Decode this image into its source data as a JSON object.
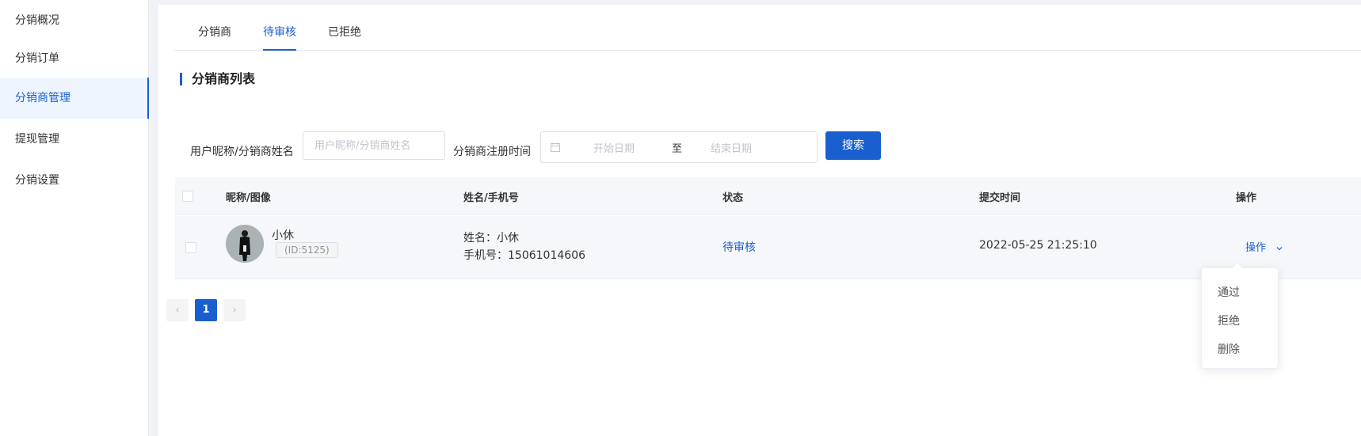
{
  "sidebar": {
    "items": [
      {
        "label": "分销概况"
      },
      {
        "label": "分销订单"
      },
      {
        "label": "分销商管理"
      },
      {
        "label": "提现管理"
      },
      {
        "label": "分销设置"
      }
    ],
    "active_index": 2
  },
  "tabs": [
    {
      "label": "分销商"
    },
    {
      "label": "待审核"
    },
    {
      "label": "已拒绝"
    }
  ],
  "active_tab": 1,
  "section_title": "分销商列表",
  "filters": {
    "name_label": "用户昵称/分销商姓名",
    "name_placeholder": "用户昵称/分销商姓名",
    "date_label": "分销商注册时间",
    "start_placeholder": "开始日期",
    "separator": "至",
    "end_placeholder": "结束日期",
    "search_button": "搜索"
  },
  "table": {
    "columns": [
      "昵称/图像",
      "姓名/手机号",
      "状态",
      "提交时间",
      "操作"
    ],
    "rows": [
      {
        "nickname": "小休",
        "id_badge": "(ID:5125)",
        "name_line": "姓名：小休",
        "phone_line": "手机号：15061014606",
        "status": "待审核",
        "submit_time": "2022-05-25 21:25:10",
        "action": "操作"
      }
    ]
  },
  "pagination": {
    "prev": "‹",
    "current": "1",
    "next": "›"
  },
  "dropdown": {
    "items": [
      "通过",
      "拒绝",
      "删除"
    ]
  },
  "colors": {
    "primary": "#1a5fd0",
    "active_bg": "#eef5fe",
    "header_bg": "#f5f7fa"
  }
}
